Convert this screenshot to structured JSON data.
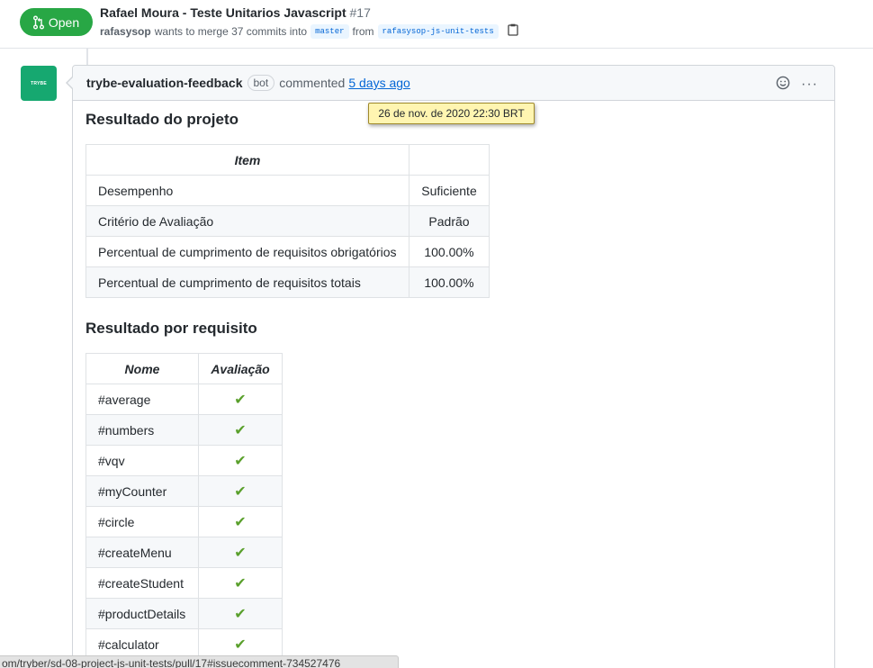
{
  "header": {
    "state_label": "Open",
    "title": "Rafael Moura - Teste Unitarios Javascript",
    "number": "#17",
    "author": "rafasysop",
    "merge_text": "wants to merge 37 commits into",
    "base_branch": "master",
    "from_text": "from",
    "head_branch": "rafasysop-js-unit-tests",
    "icons": [
      "git-pull-request-icon",
      "clipboard-icon"
    ]
  },
  "comment": {
    "avatar_text": "TRYBE",
    "author": "trybe-evaluation-feedback",
    "bot_label": "bot",
    "action": "commented",
    "time": "5 days ago",
    "tooltip": "26 de nov. de 2020 22:30 BRT",
    "icons": [
      "smiley-icon",
      "kebab-icon"
    ],
    "more_label": "···"
  },
  "project_result": {
    "heading": "Resultado do projeto",
    "columns": [
      "Item",
      ""
    ],
    "rows": [
      {
        "item": "Desempenho",
        "value": "Suficiente"
      },
      {
        "item": "Critério de Avaliação",
        "value": "Padrão"
      },
      {
        "item": "Percentual de cumprimento de requisitos obrigatórios",
        "value": "100.00%"
      },
      {
        "item": "Percentual de cumprimento de requisitos totais",
        "value": "100.00%"
      }
    ]
  },
  "requirements_result": {
    "heading": "Resultado por requisito",
    "columns": [
      "Nome",
      "Avaliação"
    ],
    "check_mark": "✔",
    "rows": [
      {
        "name": "#average"
      },
      {
        "name": "#numbers"
      },
      {
        "name": "#vqv"
      },
      {
        "name": "#myCounter"
      },
      {
        "name": "#circle"
      },
      {
        "name": "#createMenu"
      },
      {
        "name": "#createStudent"
      },
      {
        "name": "#productDetails"
      },
      {
        "name": "#calculator"
      }
    ]
  },
  "status_bar": {
    "url": "om/tryber/sd-08-project-js-unit-tests/pull/17#issuecomment-734527476"
  },
  "colors": {
    "open_green": "#28a745",
    "link_blue": "#0366d6",
    "check_green": "#5aa02c",
    "avatar_green": "#16a870",
    "tooltip_bg": "#fff5b1"
  }
}
